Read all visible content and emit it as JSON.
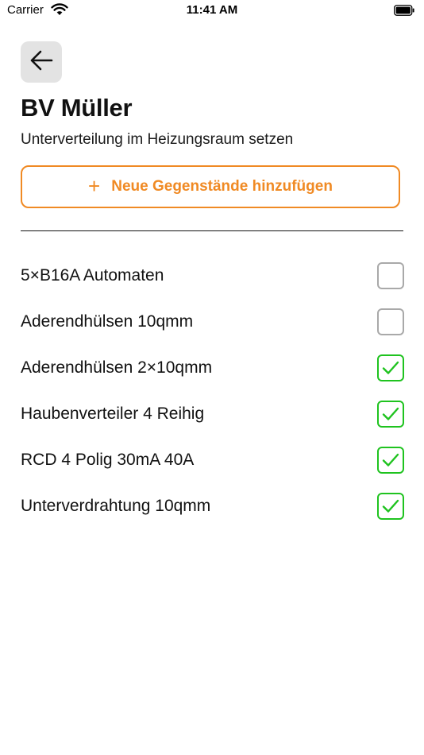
{
  "status_bar": {
    "carrier": "Carrier",
    "time": "11:41 AM"
  },
  "header": {
    "back_icon": "arrow-left-icon",
    "title": "BV Müller",
    "subtitle": "Unterverteilung im Heizungsraum setzen"
  },
  "add_button": {
    "icon": "plus-icon",
    "label": "Neue Gegenstände hinzufügen"
  },
  "colors": {
    "accent": "#f08a24",
    "checked": "#1fc31f",
    "unchecked": "#a9a9a9"
  },
  "items": [
    {
      "label": "5×B16A Automaten",
      "checked": false
    },
    {
      "label": "Aderendhülsen 10qmm",
      "checked": false
    },
    {
      "label": "Aderendhülsen 2×10qmm",
      "checked": true
    },
    {
      "label": "Haubenverteiler 4 Reihig",
      "checked": true
    },
    {
      "label": "RCD 4 Polig 30mA 40A",
      "checked": true
    },
    {
      "label": "Unterverdrahtung 10qmm",
      "checked": true
    }
  ]
}
